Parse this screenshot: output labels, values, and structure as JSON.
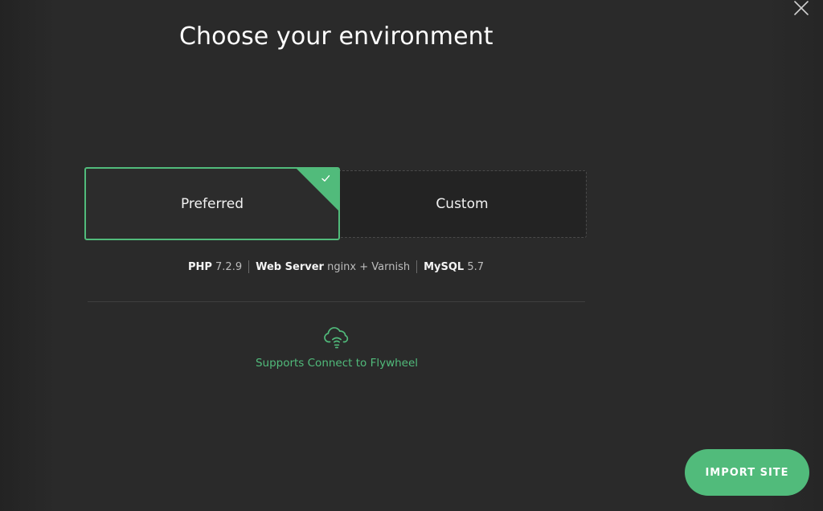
{
  "header": {
    "title": "Choose your environment"
  },
  "environments": {
    "options": [
      {
        "label": "Preferred",
        "selected": true
      },
      {
        "label": "Custom",
        "selected": false
      }
    ]
  },
  "specs": {
    "php_label": "PHP",
    "php_version": "7.2.9",
    "web_server_label": "Web Server",
    "web_server_value": "nginx + Varnish",
    "mysql_label": "MySQL",
    "mysql_version": "5.7"
  },
  "flywheel": {
    "text": "Supports Connect to Flywheel",
    "icon": "cloud-connect-icon"
  },
  "footer": {
    "import_label": "IMPORT SITE"
  },
  "colors": {
    "accent": "#51bb7b",
    "background": "#2a2a2a"
  }
}
